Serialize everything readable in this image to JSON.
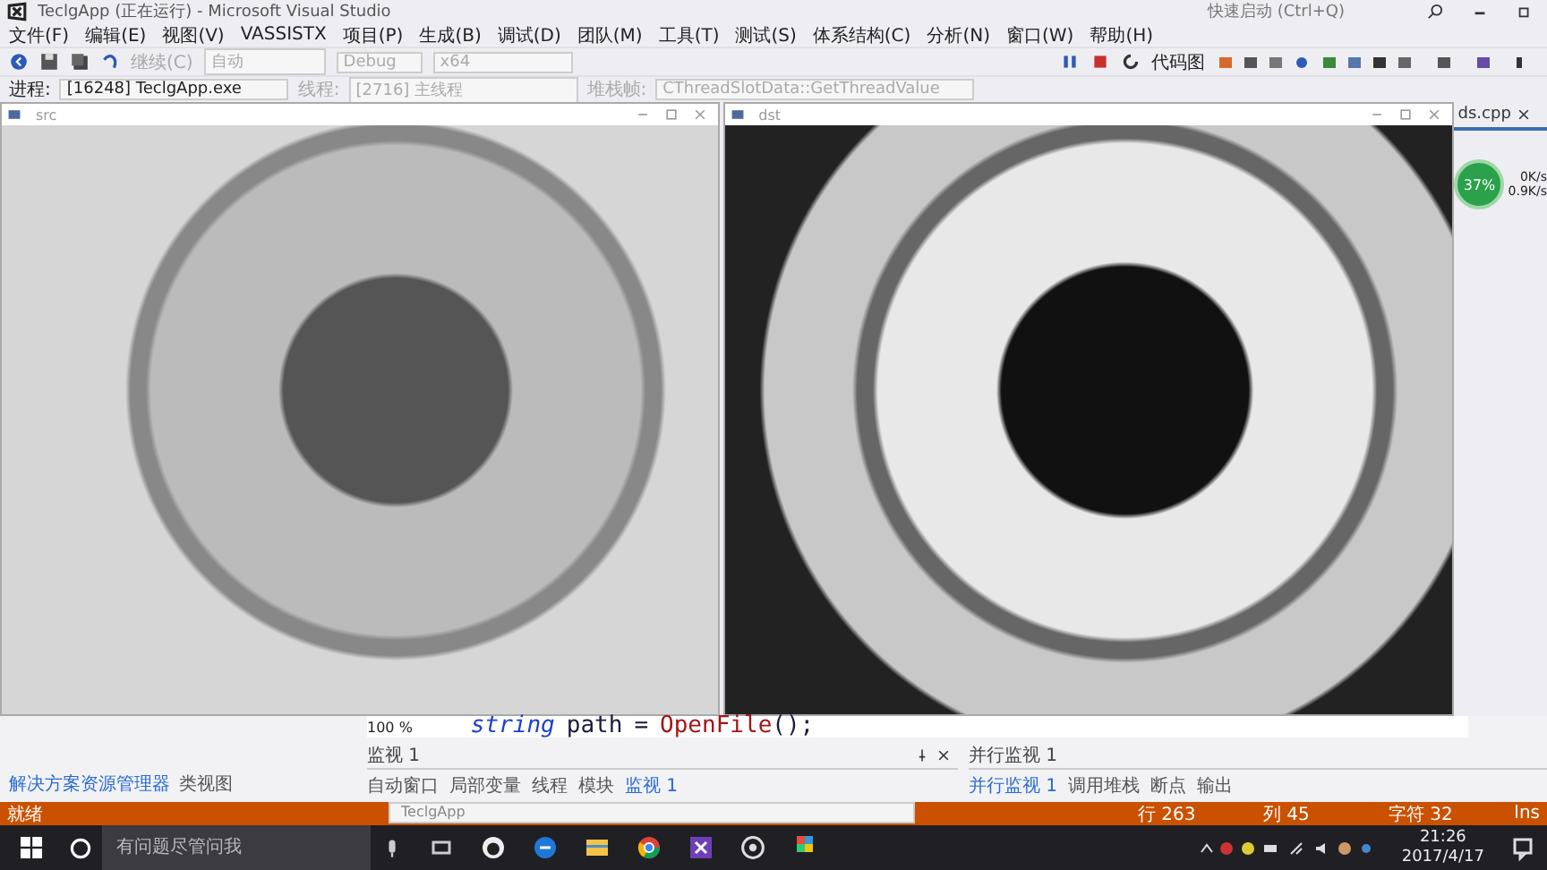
{
  "title_bar": {
    "title": "TeclgApp (正在运行) - Microsoft Visual Studio",
    "quick_launch": "快速启动 (Ctrl+Q)"
  },
  "menu": [
    "文件(F)",
    "编辑(E)",
    "视图(V)",
    "VASSISTX",
    "项目(P)",
    "生成(B)",
    "调试(D)",
    "团队(M)",
    "工具(T)",
    "测试(S)",
    "体系结构(C)",
    "分析(N)",
    "窗口(W)",
    "帮助(H)"
  ],
  "toolbar": {
    "continue": "继续(C)",
    "mode": "自动",
    "config": "Debug",
    "platform": "x64",
    "code_map": "代码图"
  },
  "debug_location": {
    "process_label": "进程:",
    "process": "[16248] TeclgApp.exe",
    "thread_label": "线程:",
    "thread": "[2716] 主线程",
    "frame_label": "堆栈帧:",
    "frame": "CThreadSlotData::GetThreadValue"
  },
  "image_windows": [
    {
      "title": "src",
      "kind": "gray"
    },
    {
      "title": "dst",
      "kind": "threshold"
    }
  ],
  "side_tab": {
    "file": "ds.cpp"
  },
  "net_meter": {
    "percent": "37%",
    "up": "0K/s",
    "down": "0.9K/s"
  },
  "editor": {
    "zoom": "100 %",
    "code": [
      {
        "text": "string",
        "kind": "type"
      },
      {
        "text": "path",
        "kind": "ident"
      },
      {
        "text": "=",
        "kind": "op"
      },
      {
        "text": "OpenFile",
        "kind": "func"
      },
      {
        "text": "();",
        "kind": "op"
      }
    ]
  },
  "explorer_tabs": [
    {
      "label": "解决方案资源管理器",
      "selected": true
    },
    {
      "label": "类视图",
      "selected": false
    }
  ],
  "watch_panel": {
    "title": "监视 1",
    "tabs": [
      {
        "label": "自动窗口",
        "selected": false
      },
      {
        "label": "局部变量",
        "selected": false
      },
      {
        "label": "线程",
        "selected": false
      },
      {
        "label": "模块",
        "selected": false
      },
      {
        "label": "监视 1",
        "selected": true
      }
    ]
  },
  "parallel_panel": {
    "title": "并行监视 1",
    "tabs": [
      {
        "label": "并行监视 1",
        "selected": true
      },
      {
        "label": "调用堆栈",
        "selected": false
      },
      {
        "label": "断点",
        "selected": false
      },
      {
        "label": "输出",
        "selected": false
      }
    ]
  },
  "status_bar": {
    "state": "就绪",
    "line": "行 263",
    "col": "列 45",
    "char": "字符 32",
    "mode": "Ins"
  },
  "taskbar": {
    "search_placeholder": "有问题尽管问我",
    "preview_title": "TeclgApp",
    "time": "21:26",
    "date": "2017/4/17"
  }
}
